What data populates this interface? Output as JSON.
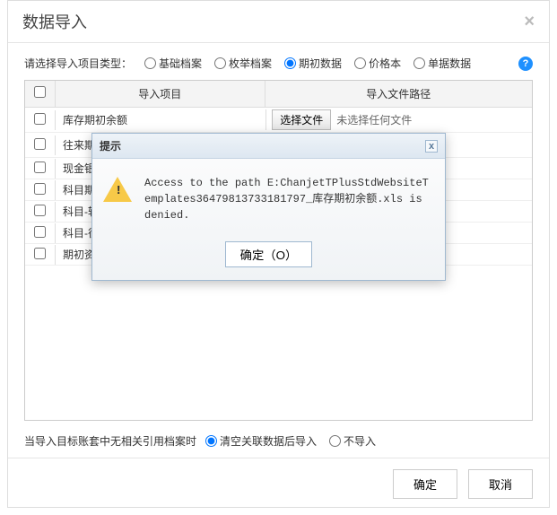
{
  "header": {
    "title": "数据导入"
  },
  "typeRow": {
    "label": "请选择导入项目类型：",
    "options": [
      "基础档案",
      "枚举档案",
      "期初数据",
      "价格本",
      "单据数据"
    ],
    "selected": 2
  },
  "grid": {
    "headers": {
      "item": "导入项目",
      "path": "导入文件路径"
    },
    "fileBtn": "选择文件",
    "noFile": "未选择任何文件",
    "rows": [
      {
        "label": "库存期初余额",
        "showFile": true
      },
      {
        "label": "往来期初余额",
        "showFile": true
      },
      {
        "label": "现金银行",
        "showFile": false
      },
      {
        "label": "科目期初",
        "showFile": false
      },
      {
        "label": "科目-辅助",
        "showFile": false
      },
      {
        "label": "科目-往来",
        "showFile": false
      },
      {
        "label": "期初资产",
        "showFile": false
      }
    ]
  },
  "bottom": {
    "label": "当导入目标账套中无相关引用档案时",
    "opts": [
      "清空关联数据后导入",
      "不导入"
    ],
    "selected": 0
  },
  "footer": {
    "ok": "确定",
    "cancel": "取消"
  },
  "alert": {
    "title": "提示",
    "message": "Access to the path E:ChanjetTPlusStdWebsiteTemplates36479813733181797_库存期初余额.xls is denied.",
    "ok": "确定（O）"
  }
}
